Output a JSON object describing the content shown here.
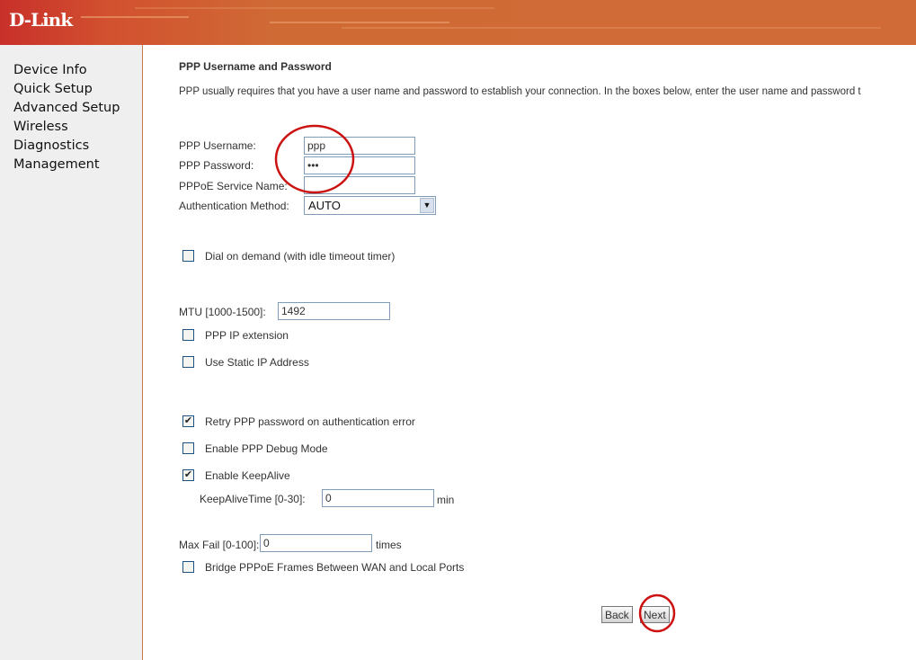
{
  "brand": {
    "logo": "D-Link"
  },
  "sidebar": {
    "items": [
      {
        "label": "Device Info"
      },
      {
        "label": "Quick Setup"
      },
      {
        "label": "Advanced Setup"
      },
      {
        "label": "Wireless"
      },
      {
        "label": "Diagnostics"
      },
      {
        "label": "Management"
      }
    ]
  },
  "main": {
    "title": "PPP Username and Password",
    "description": "PPP usually requires that you have a user name and password to establish your connection. In the boxes below, enter the user name and password t",
    "username": {
      "label": "PPP Username:",
      "value": "ppp"
    },
    "password": {
      "label": "PPP Password:",
      "value": "•••"
    },
    "service": {
      "label": "PPPoE Service Name:",
      "value": ""
    },
    "auth": {
      "label": "Authentication Method:",
      "value": "AUTO"
    },
    "dial_on_demand": {
      "label": "Dial on demand (with idle timeout timer)",
      "checked": false
    },
    "mtu": {
      "label": "MTU [1000-1500]:",
      "value": "1492"
    },
    "ip_extension": {
      "label": "PPP IP extension",
      "checked": false
    },
    "static_ip": {
      "label": "Use Static IP Address",
      "checked": false
    },
    "retry": {
      "label": "Retry PPP password on authentication error",
      "checked": true
    },
    "debug": {
      "label": "Enable PPP Debug Mode",
      "checked": false
    },
    "keepalive": {
      "label": "Enable KeepAlive",
      "checked": true
    },
    "keepalive_time": {
      "label": "KeepAliveTime [0-30]:",
      "value": "0",
      "unit": "min"
    },
    "max_fail": {
      "label": "Max Fail [0-100]:",
      "value": "0",
      "unit": "times"
    },
    "bridge": {
      "label": "Bridge PPPoE Frames Between WAN and Local Ports",
      "checked": false
    },
    "back_label": "Back",
    "next_label": "Next"
  },
  "annotation_color": "#cc1111"
}
